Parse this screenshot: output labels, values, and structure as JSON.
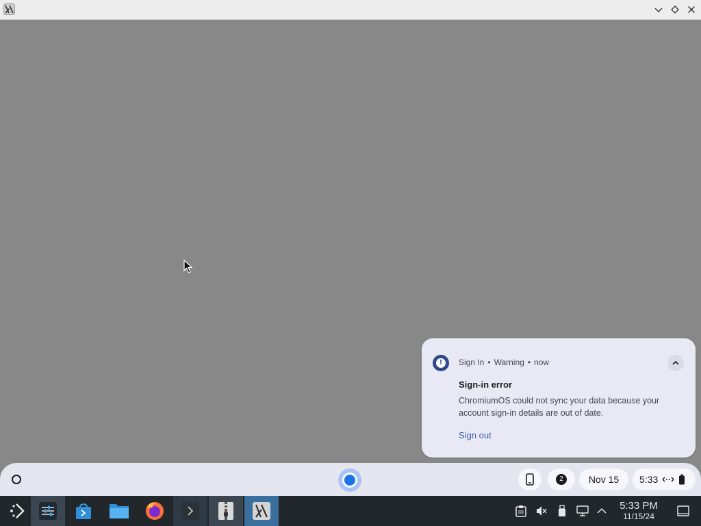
{
  "window": {
    "app_icon": "x-app-icon",
    "controls": [
      "minimize-icon",
      "maximize-icon",
      "close-icon"
    ]
  },
  "notification": {
    "icon": "warning-icon",
    "source": "Sign In",
    "separator": "•",
    "severity": "Warning",
    "time": "now",
    "title": "Sign-in error",
    "message": "ChromiumOS could not sync your data because your account sign-in details are out of date.",
    "action": "Sign out",
    "colors": {
      "accent": "#2e4a8a",
      "action": "#3b5ea8",
      "background": "#e9e9f5"
    }
  },
  "shelf": {
    "launcher_icon": "launcher-icon",
    "pinned_app": "chromium-icon",
    "phone_icon": "phone-hub-icon",
    "notification_count": "2",
    "date": "Nov 15",
    "time": "5:33",
    "status_icons": [
      "network-icon",
      "battery-icon"
    ]
  },
  "taskbar": {
    "apps": [
      {
        "name": "start-menu-icon"
      },
      {
        "name": "settings-app-icon"
      },
      {
        "name": "store-app-icon"
      },
      {
        "name": "file-manager-icon"
      },
      {
        "name": "firefox-icon"
      },
      {
        "name": "terminal-icon"
      },
      {
        "name": "archive-manager-icon"
      },
      {
        "name": "x-app-icon"
      }
    ],
    "tray": [
      "clipboard-icon",
      "volume-muted-icon",
      "usb-icon",
      "network-icon",
      "expand-tray-icon"
    ],
    "clock_time": "5:33 PM",
    "clock_date": "11/15/24",
    "show_desktop": "show-desktop-icon"
  }
}
